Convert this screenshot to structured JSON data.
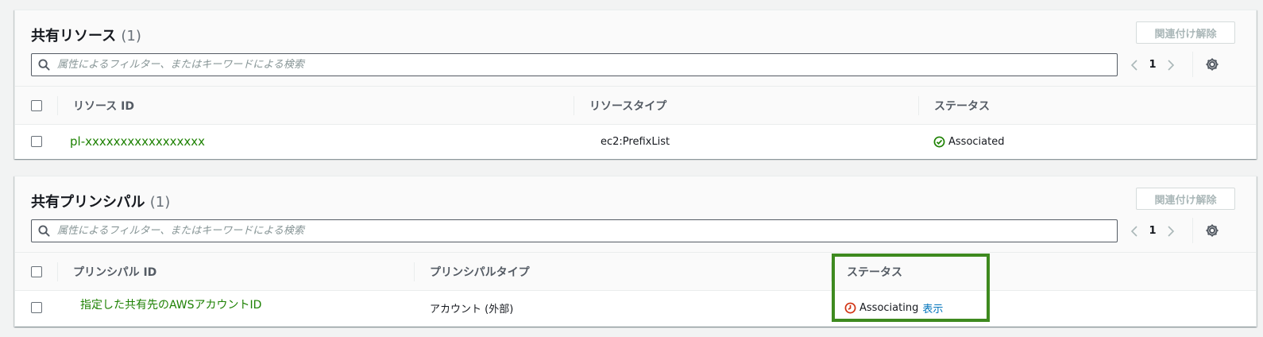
{
  "resources": {
    "title": "共有リソース",
    "count": "(1)",
    "disassociate_label": "関連付け解除",
    "filter_placeholder": "属性によるフィルター、またはキーワードによる検索",
    "page": "1",
    "columns": [
      "リソース ID",
      "リソースタイプ",
      "ステータス"
    ],
    "rows": [
      {
        "id": "pl-xxxxxxxxxxxxxxxxx",
        "type": "ec2:PrefixList",
        "status": "Associated"
      }
    ]
  },
  "principals": {
    "title": "共有プリンシパル",
    "count": "(1)",
    "disassociate_label": "関連付け解除",
    "filter_placeholder": "属性によるフィルター、またはキーワードによる検索",
    "page": "1",
    "columns": [
      "プリンシパル ID",
      "プリンシパルタイプ",
      "ステータス"
    ],
    "rows": [
      {
        "id": "指定した共有先のAWSアカウントID",
        "type": "アカウント (外部)",
        "status": "Associating",
        "status_link": "表示"
      }
    ]
  },
  "colors": {
    "link_green": "#1d8102",
    "link_blue": "#0073bb",
    "status_success": "#1d8102",
    "status_pending": "#d13212",
    "highlight": "#3e8a1f"
  },
  "icons": [
    "search-icon",
    "chevron-left-icon",
    "chevron-right-icon",
    "gear-icon",
    "check-circle-icon",
    "clock-icon"
  ]
}
